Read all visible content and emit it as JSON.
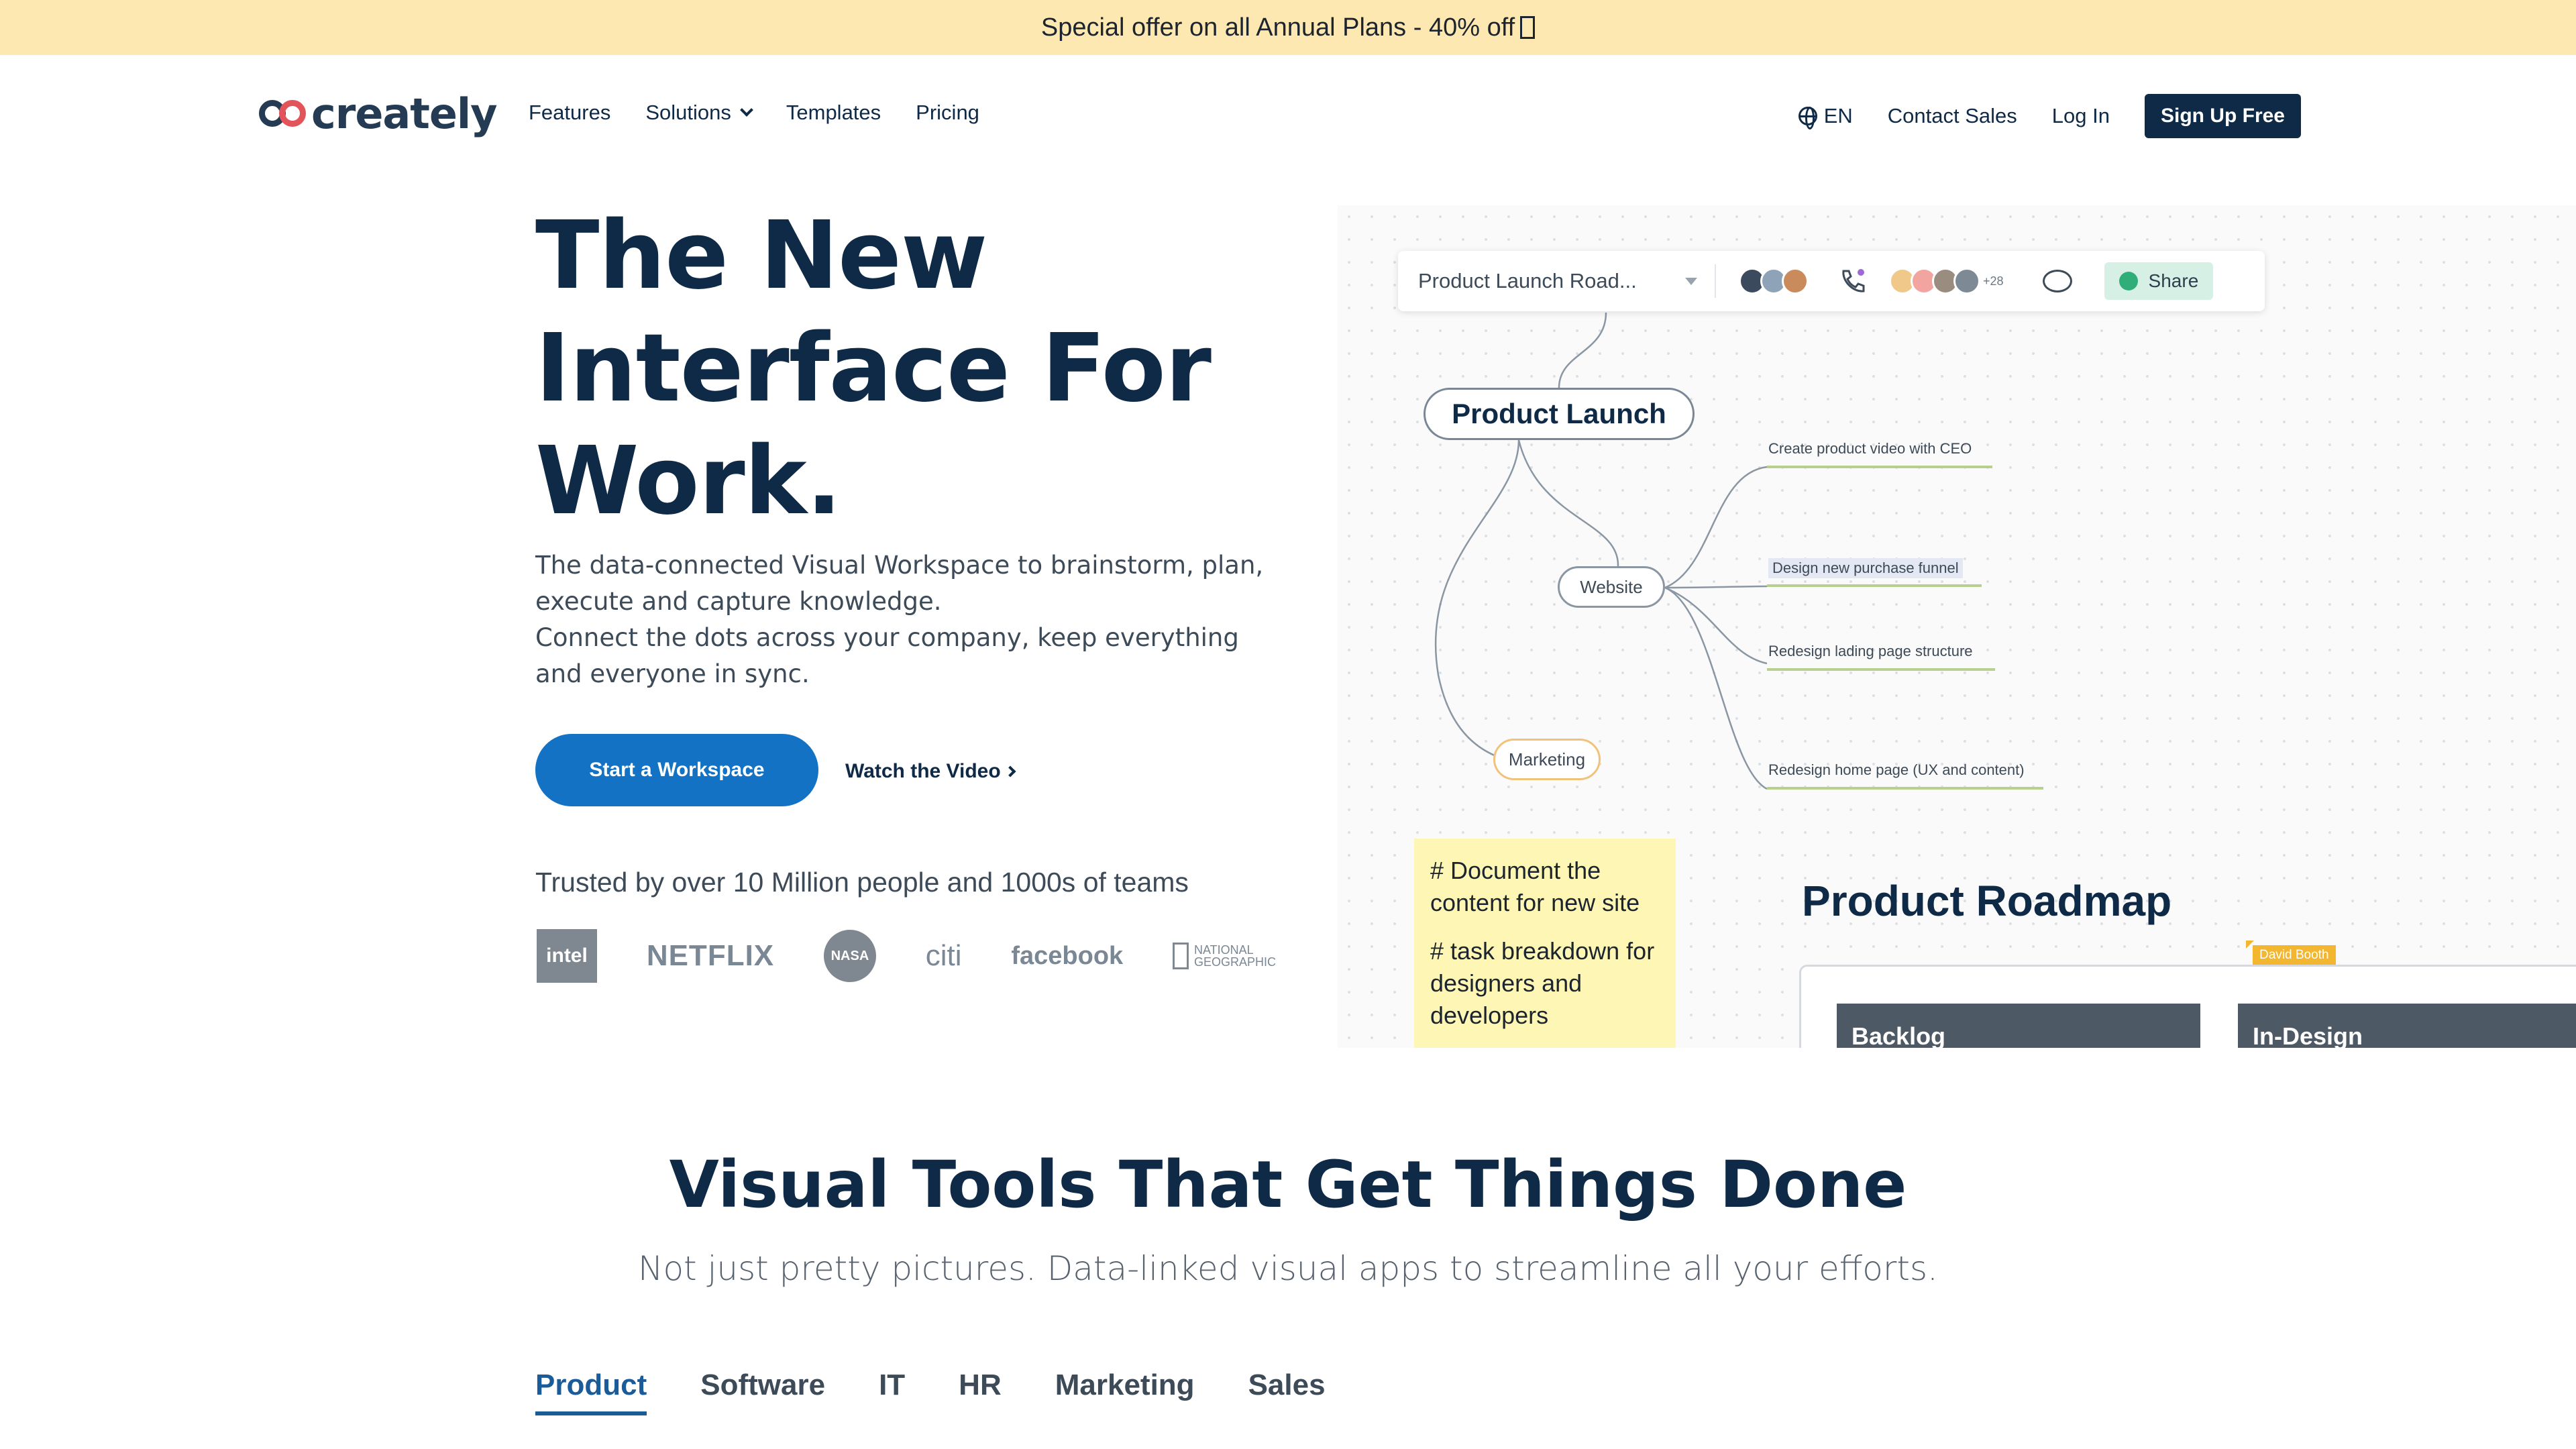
{
  "promo": {
    "text": "Special offer on all Annual Plans - 40% off"
  },
  "nav": {
    "logo_text": "creately",
    "links": [
      "Features",
      "Solutions",
      "Templates",
      "Pricing"
    ],
    "language": "EN",
    "contact_sales": "Contact Sales",
    "login": "Log In",
    "signup": "Sign Up Free"
  },
  "hero": {
    "title": "The New Interface For Work.",
    "description_1": "The data-connected Visual Workspace to brainstorm, plan, execute and capture knowledge.",
    "description_2": "Connect the dots across your company, keep everything and everyone in sync.",
    "cta_primary": "Start a Workspace",
    "cta_video": "Watch the Video",
    "trusted": "Trusted by over 10 Million people and 1000s of teams",
    "brands": [
      "intel",
      "NETFLIX",
      "NASA",
      "citi",
      "facebook",
      "NATIONAL GEOGRAPHIC"
    ]
  },
  "canvas": {
    "doc_name": "Product Launch Road...",
    "more_collaborators": "+28",
    "share": "Share",
    "main_node": "Product Launch",
    "nodes": {
      "website": "Website",
      "marketing": "Marketing"
    },
    "leaves": [
      "Create product video with CEO",
      "Design new purchase funnel",
      "Redesign lading page structure",
      "Redesign home page (UX and content)"
    ],
    "sticky_1": "# Document the content for new site",
    "sticky_2": "# task breakdown for designers and developers",
    "roadmap_title": "Product Roadmap",
    "cursor_user": "David Booth",
    "columns": [
      "Backlog",
      "In-Design"
    ],
    "avatar_colors": [
      "#3b4a5c",
      "#8fa3b8",
      "#c98a5c",
      "#f0c98a",
      "#f2a5a0",
      "#9a8c7e",
      "#7d8a96"
    ]
  },
  "section": {
    "title": "Visual Tools That Get Things Done",
    "subtitle": "Not just pretty pictures. Data-linked visual apps to streamline all your efforts.",
    "tabs": [
      "Product",
      "Software",
      "IT",
      "HR",
      "Marketing",
      "Sales"
    ],
    "active_tab": "Product"
  },
  "colors": {
    "brand_navy": "#0e2a47",
    "primary_blue": "#1372c4",
    "promo_bg": "#fde8b1",
    "accent_red": "#e2545a"
  }
}
